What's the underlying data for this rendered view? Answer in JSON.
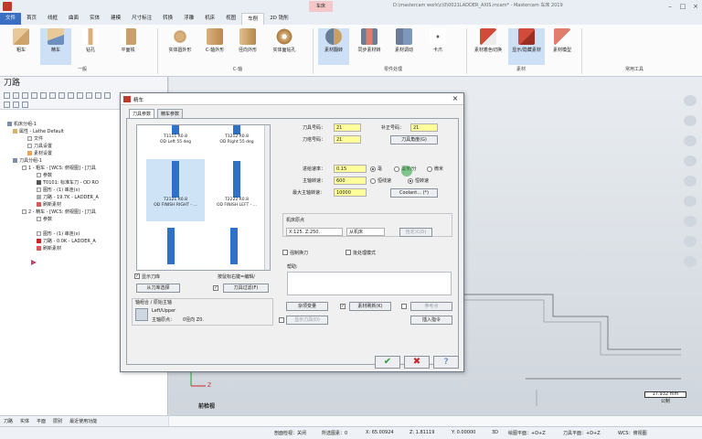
{
  "window": {
    "context_tab": "车床",
    "title": "D:\\mastercam work\\c\\0\\0021LADDER_AXIS.mcam* - Mastercam 车床 2019"
  },
  "ribbon_tabs": [
    "文件",
    "首页",
    "线框",
    "曲面",
    "实体",
    "建模",
    "尺寸标注",
    "转换",
    "浮雕",
    "机床",
    "视图",
    "车削",
    "2D 铣削"
  ],
  "ribbon": {
    "buttons": [
      "粗车",
      "精车",
      "钻孔",
      "平面铣",
      "实体圆外形",
      "C-轴外形",
      "径向外形",
      "实体面钻孔",
      "素材翻转",
      "同步素材转",
      "素材调动",
      "卡爪",
      "素材着色切换",
      "显示/隐藏素材",
      "素材模型"
    ],
    "groups": [
      "一般",
      "C-轴",
      "零件处理",
      "素材",
      "常用工具"
    ]
  },
  "left_panel": {
    "title": "刀路",
    "tree": [
      "机床分组-1",
      "属性 - Lathe Default",
      "文件",
      "刀具设置",
      "素材设置",
      "刀具分组-1",
      "1 - 粗车 - [WCS: 俯视图] - [刀具",
      "参数",
      "T0101: 标准车刀 - OD RO",
      "图形 - (1) 串连(s)",
      "刀路 - 19.7K - LADDER_A",
      "刷新素材",
      "2 - 精车 - [WCS: 俯视图] - [刀具",
      "参数",
      "图形 - (1) 串连(s)",
      "刀路 - 0.0K - LADDER_A",
      "刷新素材"
    ]
  },
  "bottom_tabs": [
    "刀路",
    "实体",
    "平面",
    "层别",
    "最近使用功能"
  ],
  "view_label": "前检视",
  "scale": {
    "value": "17.932 mm",
    "unit": "公制"
  },
  "status": {
    "section": "剖面检视：关闭",
    "selected": "所选图素：0",
    "x": "X:  65.00924",
    "z": "Z:  1.81119",
    "y": "Y:  0.00000",
    "mode": "3D",
    "plane": "绘图平面：+D+Z",
    "tplane": "刀具平面：+D+Z",
    "wcs": "WCS：俯视图"
  },
  "dialog": {
    "title": "精车",
    "tabs": [
      "刀具参数",
      "精车参数"
    ],
    "tools": [
      {
        "code": "T1111  R0.8",
        "desc": "OD Left 55 deg"
      },
      {
        "code": "T1212  R0.8",
        "desc": "OD Right 55 deg"
      },
      {
        "code": "T2121  R0.8",
        "desc": "OD FINISH RIGHT - ..."
      },
      {
        "code": "T2222  R0.8",
        "desc": "OD FINISH LEFT - ..."
      }
    ],
    "tool_no_label": "刀具号码：",
    "tool_no": "21",
    "offset_no_label": "补正号码：",
    "offset_no": "21",
    "station_label": "刀塔号码：",
    "station": "21",
    "tool_angle_btn": "刀具角度(G)",
    "feed_label": "进给速率：",
    "feed": "0.15",
    "feed_units": [
      "毫",
      "毫米/分",
      "微米"
    ],
    "spindle_label": "主轴转速：",
    "spindle": "600",
    "spindle_units": [
      "恒线速",
      "恒转速"
    ],
    "max_spindle_label": "最大主轴转速：",
    "max_spindle": "10000",
    "coolant_btn": "Coolant...  (*)",
    "home_label": "机床原点",
    "home_value": "X:125.  Z:250.",
    "home_source": "从机床",
    "home_define_btn": "自定义(D)",
    "force_change": "强制换刀",
    "batch_mode": "批处理模式",
    "comment_label": "帮助:",
    "show_tools": "显示刀库",
    "pick_hint": "按鼠标右键=编辑/",
    "from_lib_btn": "从刀库选择",
    "filter_btn": "刀具过滤(F)",
    "axis_combo_label": "轴组合 / 原始主轴",
    "axis_combo": "Left/Upper",
    "spindle_origin": "主轴原点：",
    "spindle_origin_value": "0径向 Z0.",
    "misc_btn": "杂项变量",
    "refresh_stock_btn": "素材刷新(K)",
    "ref_point_btn": "参考点",
    "show_tool_btn": "显示刀具(D)",
    "insert_btn": "插入指令",
    "ok_icon": "check-icon",
    "cancel_icon": "x-icon",
    "help_icon": "help-icon"
  }
}
